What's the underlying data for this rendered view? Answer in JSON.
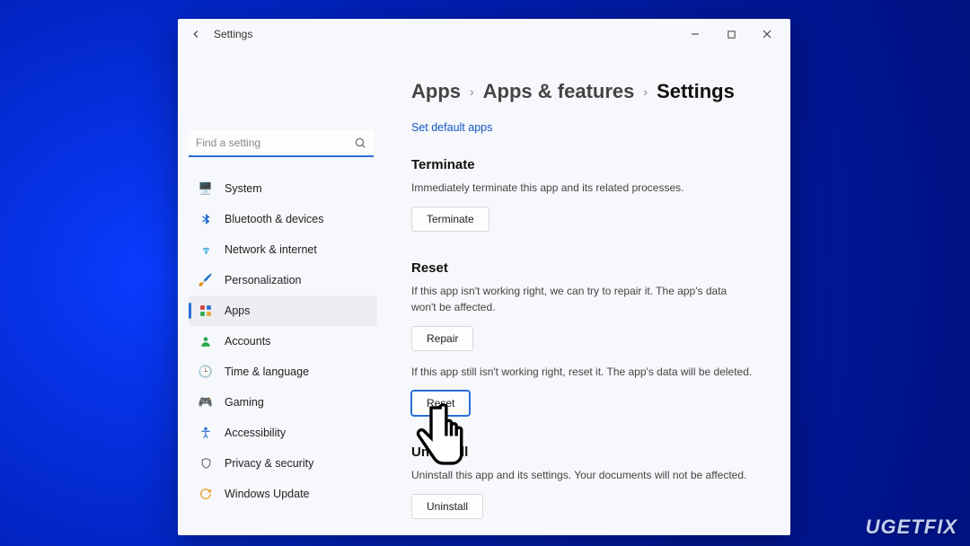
{
  "window": {
    "title": "Settings"
  },
  "search": {
    "placeholder": "Find a setting"
  },
  "sidebar": {
    "items": [
      {
        "label": "System"
      },
      {
        "label": "Bluetooth & devices"
      },
      {
        "label": "Network & internet"
      },
      {
        "label": "Personalization"
      },
      {
        "label": "Apps"
      },
      {
        "label": "Accounts"
      },
      {
        "label": "Time & language"
      },
      {
        "label": "Gaming"
      },
      {
        "label": "Accessibility"
      },
      {
        "label": "Privacy & security"
      },
      {
        "label": "Windows Update"
      }
    ]
  },
  "breadcrumb": {
    "level1": "Apps",
    "level2": "Apps & features",
    "level3": "Settings"
  },
  "content": {
    "default_apps_link": "Set default apps",
    "terminate": {
      "title": "Terminate",
      "desc": "Immediately terminate this app and its related processes.",
      "button": "Terminate"
    },
    "reset": {
      "title": "Reset",
      "repair_desc": "If this app isn't working right, we can try to repair it. The app's data won't be affected.",
      "repair_button": "Repair",
      "reset_desc": "If this app still isn't working right, reset it. The app's data will be deleted.",
      "reset_button": "Reset"
    },
    "uninstall": {
      "title": "Uninstall",
      "desc": "Uninstall this app and its settings. Your documents will not be affected.",
      "button": "Uninstall"
    }
  },
  "watermark": "UGETFIX"
}
